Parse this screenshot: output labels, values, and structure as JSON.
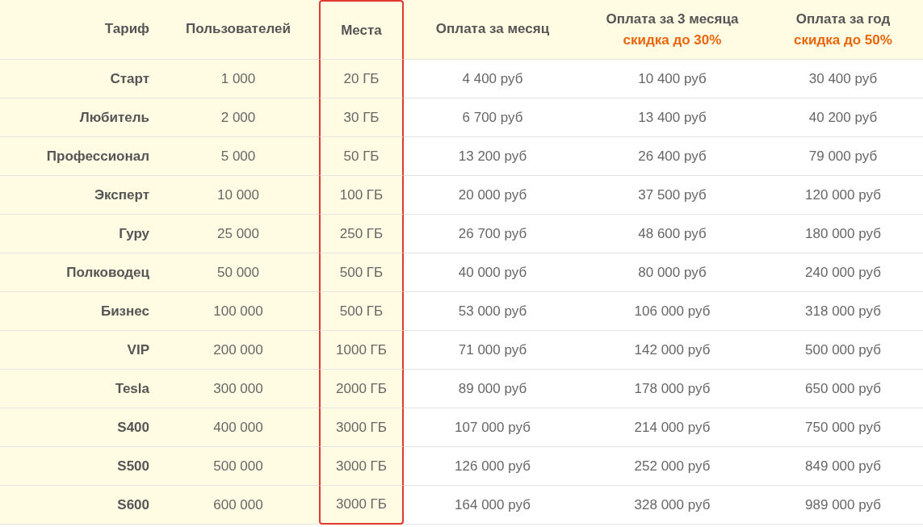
{
  "table": {
    "columns": [
      {
        "label": "Тариф",
        "shaded": true,
        "highlighted": false
      },
      {
        "label": "Пользователей",
        "shaded": true,
        "highlighted": false
      },
      {
        "label": "Места",
        "shaded": true,
        "highlighted": true
      },
      {
        "label": "Оплата за месяц",
        "shaded": false,
        "highlighted": false
      },
      {
        "label": "Оплата за 3 месяца",
        "note": "скидка до 30%",
        "shaded": false,
        "highlighted": false
      },
      {
        "label": "Оплата за год",
        "note": "скидка до 50%",
        "shaded": false,
        "highlighted": false
      }
    ],
    "rows": [
      [
        "Старт",
        "1 000",
        "20 ГБ",
        "4 400 руб",
        "10 400 руб",
        "30 400 руб"
      ],
      [
        "Любитель",
        "2 000",
        "30 ГБ",
        "6 700 руб",
        "13 400 руб",
        "40 200 руб"
      ],
      [
        "Профессионал",
        "5 000",
        "50 ГБ",
        "13 200 руб",
        "26 400 руб",
        "79 000 руб"
      ],
      [
        "Эксперт",
        "10 000",
        "100 ГБ",
        "20 000 руб",
        "37 500 руб",
        "120 000 руб"
      ],
      [
        "Гуру",
        "25 000",
        "250 ГБ",
        "26 700 руб",
        "48 600 руб",
        "180 000 руб"
      ],
      [
        "Полководец",
        "50 000",
        "500 ГБ",
        "40 000 руб",
        "80 000 руб",
        "240 000 руб"
      ],
      [
        "Бизнес",
        "100 000",
        "500 ГБ",
        "53 000 руб",
        "106 000 руб",
        "318 000 руб"
      ],
      [
        "VIP",
        "200 000",
        "1000 ГБ",
        "71 000 руб",
        "142 000 руб",
        "500 000 руб"
      ],
      [
        "Tesla",
        "300 000",
        "2000 ГБ",
        "89 000 руб",
        "178 000 руб",
        "650 000 руб"
      ],
      [
        "S400",
        "400 000",
        "3000 ГБ",
        "107 000 руб",
        "214 000 руб",
        "750 000 руб"
      ],
      [
        "S500",
        "500 000",
        "3000 ГБ",
        "126 000 руб",
        "252 000 руб",
        "849 000 руб"
      ],
      [
        "S600",
        "600 000",
        "3000 ГБ",
        "164 000 руб",
        "328 000 руб",
        "989 000 руб"
      ]
    ]
  }
}
